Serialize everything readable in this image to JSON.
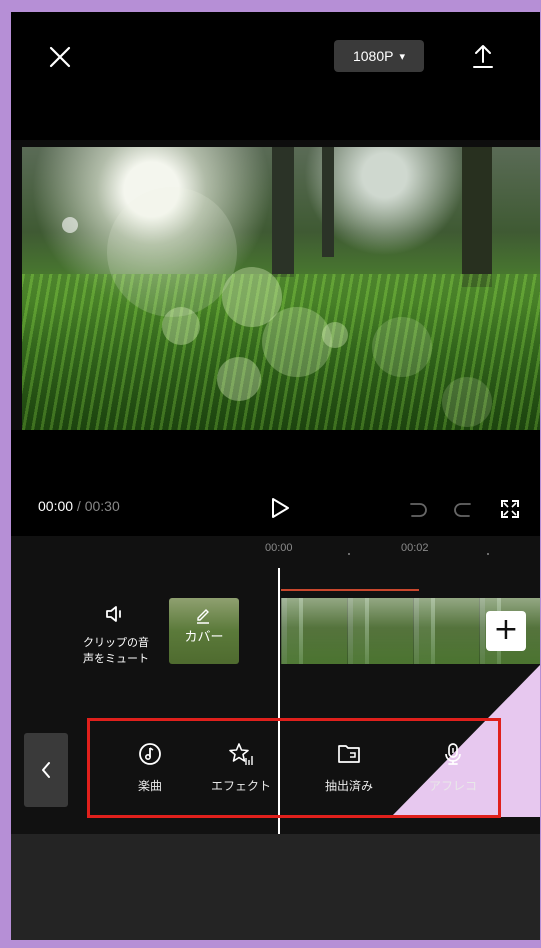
{
  "header": {
    "resolution_label": "1080P",
    "resolution_caret": "▾"
  },
  "player": {
    "current_time": "00:00",
    "separator": " / ",
    "total_time": "00:30"
  },
  "timeline": {
    "ruler": [
      "00:00",
      "00:02"
    ],
    "mute_label_line1": "クリップの音",
    "mute_label_line2": "声をミュート",
    "cover_label": "カバー",
    "add_label": "+"
  },
  "toolbar": {
    "items": [
      {
        "label": "楽曲",
        "icon": "music-note-icon"
      },
      {
        "label": "エフェクト",
        "icon": "sparkle-star-icon"
      },
      {
        "label": "抽出済み",
        "icon": "folder-icon"
      },
      {
        "label": "アフレコ",
        "icon": "microphone-icon"
      }
    ]
  },
  "colors": {
    "frame": "#b68fd6",
    "highlight": "#e0201c",
    "pointer": "#e7c8ef",
    "timeline_marker": "#c9472d"
  }
}
